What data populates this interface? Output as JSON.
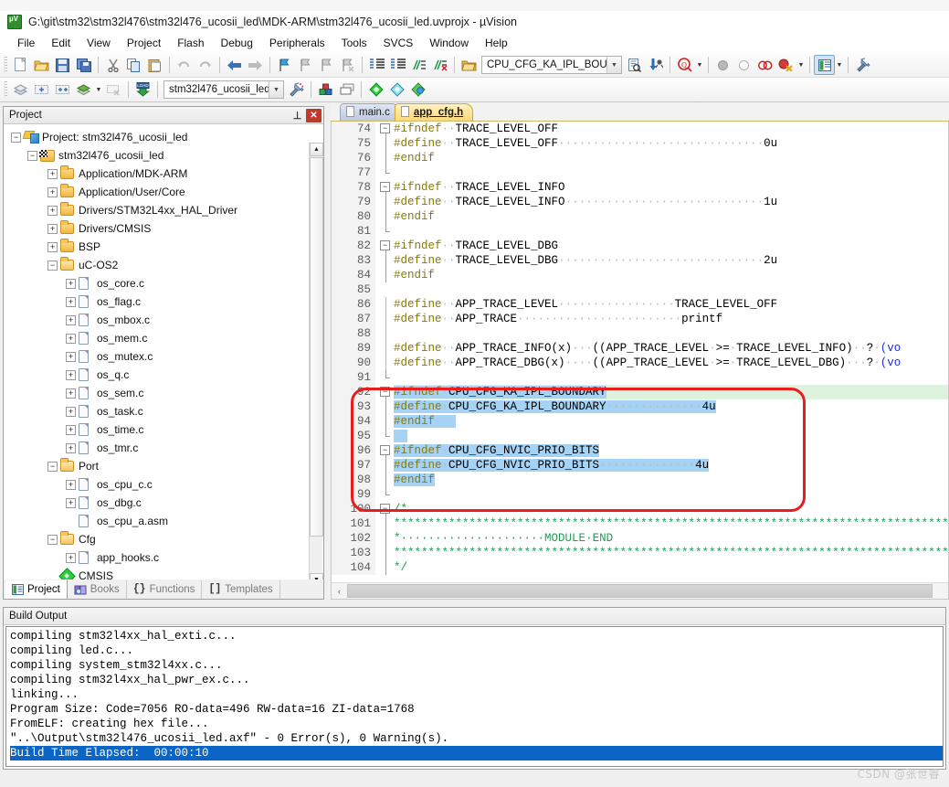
{
  "window": {
    "title": "G:\\git\\stm32\\stm32l476\\stm32l476_ucosii_led\\MDK-ARM\\stm32l476_ucosii_led.uvprojx - µVision",
    "app_icon": "uvision-icon"
  },
  "menubar": {
    "items": [
      {
        "label": "File"
      },
      {
        "label": "Edit"
      },
      {
        "label": "View"
      },
      {
        "label": "Project"
      },
      {
        "label": "Flash"
      },
      {
        "label": "Debug"
      },
      {
        "label": "Peripherals"
      },
      {
        "label": "Tools"
      },
      {
        "label": "SVCS"
      },
      {
        "label": "Window"
      },
      {
        "label": "Help"
      }
    ]
  },
  "toolbar": {
    "target_combo_value": "stm32l476_ucosii_led",
    "search_combo_value": "CPU_CFG_KA_IPL_BOUND",
    "row1_icons": [
      "new-file-icon",
      "open-file-icon",
      "save-icon",
      "save-all-icon",
      "cut-icon",
      "copy-icon",
      "paste-icon",
      "undo-icon",
      "redo-icon",
      "navigate-back-icon",
      "navigate-forward-icon",
      "bookmark-toggle-icon",
      "bookmark-prev-icon",
      "bookmark-next-icon",
      "bookmark-clear-icon",
      "indent-icon",
      "outdent-icon",
      "comment-icon",
      "uncomment-icon"
    ],
    "row2_icons": [
      "build-icon",
      "rebuild-icon",
      "batch-build-icon",
      "translate-icon",
      "stop-build-icon",
      "download-icon"
    ],
    "row2_right_icons": [
      "target-options-icon",
      "manage-components-icon",
      "pack-installer-icon",
      "config-wizard-icon",
      "svcs-icon"
    ],
    "row1_right_icons": [
      "find-in-files-icon",
      "debug-start-icon",
      "breakpoint-icon",
      "breakpoint-disable-icon",
      "breakpoint-disable-all-icon",
      "breakpoint-kill-icon",
      "project-window-icon",
      "utilities-icon"
    ]
  },
  "project_panel": {
    "caption": "Project",
    "pin_icon": "pin-icon",
    "close_icon": "close-icon",
    "tree": [
      {
        "label": "Project: stm32l476_ucosii_led",
        "indent": 0,
        "expander": "-",
        "icon": "project-icon"
      },
      {
        "label": "stm32l476_ucosii_led",
        "indent": 1,
        "expander": "-",
        "icon": "target-icon"
      },
      {
        "label": "Application/MDK-ARM",
        "indent": 2,
        "expander": "+",
        "icon": "folder-icon"
      },
      {
        "label": "Application/User/Core",
        "indent": 2,
        "expander": "+",
        "icon": "folder-icon"
      },
      {
        "label": "Drivers/STM32L4xx_HAL_Driver",
        "indent": 2,
        "expander": "+",
        "icon": "folder-icon"
      },
      {
        "label": "Drivers/CMSIS",
        "indent": 2,
        "expander": "+",
        "icon": "folder-icon"
      },
      {
        "label": "BSP",
        "indent": 2,
        "expander": "+",
        "icon": "folder-icon"
      },
      {
        "label": "uC-OS2",
        "indent": 2,
        "expander": "-",
        "icon": "folder-open-icon"
      },
      {
        "label": "os_core.c",
        "indent": 3,
        "expander": "+",
        "icon": "source-file-icon"
      },
      {
        "label": "os_flag.c",
        "indent": 3,
        "expander": "+",
        "icon": "source-file-icon"
      },
      {
        "label": "os_mbox.c",
        "indent": 3,
        "expander": "+",
        "icon": "source-file-icon"
      },
      {
        "label": "os_mem.c",
        "indent": 3,
        "expander": "+",
        "icon": "source-file-icon"
      },
      {
        "label": "os_mutex.c",
        "indent": 3,
        "expander": "+",
        "icon": "source-file-icon"
      },
      {
        "label": "os_q.c",
        "indent": 3,
        "expander": "+",
        "icon": "source-file-icon"
      },
      {
        "label": "os_sem.c",
        "indent": 3,
        "expander": "+",
        "icon": "source-file-icon"
      },
      {
        "label": "os_task.c",
        "indent": 3,
        "expander": "+",
        "icon": "source-file-icon"
      },
      {
        "label": "os_time.c",
        "indent": 3,
        "expander": "+",
        "icon": "source-file-icon"
      },
      {
        "label": "os_tmr.c",
        "indent": 3,
        "expander": "+",
        "icon": "source-file-icon"
      },
      {
        "label": "Port",
        "indent": 2,
        "expander": "-",
        "icon": "folder-open-icon"
      },
      {
        "label": "os_cpu_c.c",
        "indent": 3,
        "expander": "+",
        "icon": "source-file-icon"
      },
      {
        "label": "os_dbg.c",
        "indent": 3,
        "expander": "+",
        "icon": "source-file-icon"
      },
      {
        "label": "os_cpu_a.asm",
        "indent": 3,
        "expander": "",
        "icon": "source-file-icon"
      },
      {
        "label": "Cfg",
        "indent": 2,
        "expander": "-",
        "icon": "folder-open-icon"
      },
      {
        "label": "app_hooks.c",
        "indent": 3,
        "expander": "+",
        "icon": "source-file-icon"
      },
      {
        "label": "CMSIS",
        "indent": 2,
        "expander": "",
        "icon": "cmsis-icon"
      }
    ],
    "bottom_tabs": [
      {
        "label": "Project",
        "selected": true,
        "icon": "project-tab-icon"
      },
      {
        "label": "Books",
        "selected": false,
        "icon": "books-tab-icon"
      },
      {
        "label": "Functions",
        "selected": false,
        "icon": "functions-tab-icon"
      },
      {
        "label": "Templates",
        "selected": false,
        "icon": "templates-tab-icon"
      }
    ]
  },
  "editor": {
    "tabs": [
      {
        "label": "main.c",
        "active": false,
        "icon": "file-tab-icon"
      },
      {
        "label": "app_cfg.h",
        "active": true,
        "icon": "file-tab-icon"
      }
    ],
    "lines": [
      {
        "n": 74,
        "fold": "box-minus",
        "segs": [
          {
            "t": "#ifndef",
            "c": "kw"
          },
          {
            "t": "··",
            "c": "dots"
          },
          {
            "t": "TRACE_LEVEL_OFF",
            "c": ""
          }
        ]
      },
      {
        "n": 75,
        "fold": "line",
        "segs": [
          {
            "t": "#define",
            "c": "kw"
          },
          {
            "t": "··",
            "c": "dots"
          },
          {
            "t": "TRACE_LEVEL_OFF",
            "c": ""
          },
          {
            "t": "······························",
            "c": "dots"
          },
          {
            "t": "0u",
            "c": ""
          }
        ]
      },
      {
        "n": 76,
        "fold": "line",
        "segs": [
          {
            "t": "#endif",
            "c": "kw"
          }
        ]
      },
      {
        "n": 77,
        "fold": "tick",
        "segs": []
      },
      {
        "n": 78,
        "fold": "box-minus",
        "segs": [
          {
            "t": "#ifndef",
            "c": "kw"
          },
          {
            "t": "··",
            "c": "dots"
          },
          {
            "t": "TRACE_LEVEL_INFO",
            "c": ""
          }
        ]
      },
      {
        "n": 79,
        "fold": "line",
        "segs": [
          {
            "t": "#define",
            "c": "kw"
          },
          {
            "t": "··",
            "c": "dots"
          },
          {
            "t": "TRACE_LEVEL_INFO",
            "c": ""
          },
          {
            "t": "·····························",
            "c": "dots"
          },
          {
            "t": "1u",
            "c": ""
          }
        ]
      },
      {
        "n": 80,
        "fold": "line",
        "segs": [
          {
            "t": "#endif",
            "c": "kw"
          }
        ]
      },
      {
        "n": 81,
        "fold": "tick",
        "segs": []
      },
      {
        "n": 82,
        "fold": "box-minus",
        "segs": [
          {
            "t": "#ifndef",
            "c": "kw"
          },
          {
            "t": "··",
            "c": "dots"
          },
          {
            "t": "TRACE_LEVEL_DBG",
            "c": ""
          }
        ]
      },
      {
        "n": 83,
        "fold": "line",
        "segs": [
          {
            "t": "#define",
            "c": "kw"
          },
          {
            "t": "··",
            "c": "dots"
          },
          {
            "t": "TRACE_LEVEL_DBG",
            "c": ""
          },
          {
            "t": "······························",
            "c": "dots"
          },
          {
            "t": "2u",
            "c": ""
          }
        ]
      },
      {
        "n": 84,
        "fold": "line",
        "segs": [
          {
            "t": "#endif",
            "c": "kw"
          }
        ]
      },
      {
        "n": 85,
        "fold": "none",
        "segs": []
      },
      {
        "n": 86,
        "fold": "line2",
        "segs": [
          {
            "t": "#define",
            "c": "kw"
          },
          {
            "t": "··",
            "c": "dots"
          },
          {
            "t": "APP_TRACE_LEVEL",
            "c": ""
          },
          {
            "t": "·················",
            "c": "dots"
          },
          {
            "t": "TRACE_LEVEL_OFF",
            "c": ""
          }
        ]
      },
      {
        "n": 87,
        "fold": "line2",
        "segs": [
          {
            "t": "#define",
            "c": "kw"
          },
          {
            "t": "··",
            "c": "dots"
          },
          {
            "t": "APP_TRACE",
            "c": ""
          },
          {
            "t": "························",
            "c": "dots"
          },
          {
            "t": "printf",
            "c": ""
          }
        ]
      },
      {
        "n": 88,
        "fold": "line2",
        "segs": []
      },
      {
        "n": 89,
        "fold": "line2",
        "segs": [
          {
            "t": "#define",
            "c": "kw"
          },
          {
            "t": "··",
            "c": "dots"
          },
          {
            "t": "APP_TRACE_INFO(x)",
            "c": ""
          },
          {
            "t": "···",
            "c": "dots"
          },
          {
            "t": "((APP_TRACE_LEVEL",
            "c": ""
          },
          {
            "t": "·",
            "c": "dots"
          },
          {
            "t": ">=",
            "c": ""
          },
          {
            "t": "·",
            "c": "dots"
          },
          {
            "t": "TRACE_LEVEL_INFO)",
            "c": ""
          },
          {
            "t": "··",
            "c": "dots"
          },
          {
            "t": "?",
            "c": ""
          },
          {
            "t": "·",
            "c": "dots"
          },
          {
            "t": "(vo",
            "c": "blu"
          }
        ]
      },
      {
        "n": 90,
        "fold": "line2",
        "segs": [
          {
            "t": "#define",
            "c": "kw"
          },
          {
            "t": "··",
            "c": "dots"
          },
          {
            "t": "APP_TRACE_DBG(x)",
            "c": ""
          },
          {
            "t": "····",
            "c": "dots"
          },
          {
            "t": "((APP_TRACE_LEVEL",
            "c": ""
          },
          {
            "t": "·",
            "c": "dots"
          },
          {
            "t": ">=",
            "c": ""
          },
          {
            "t": "·",
            "c": "dots"
          },
          {
            "t": "TRACE_LEVEL_DBG)",
            "c": ""
          },
          {
            "t": "···",
            "c": "dots"
          },
          {
            "t": "?",
            "c": ""
          },
          {
            "t": "·",
            "c": "dots"
          },
          {
            "t": "(vo",
            "c": "blu"
          }
        ]
      },
      {
        "n": 91,
        "fold": "tick",
        "segs": []
      },
      {
        "n": 92,
        "fold": "box-minus",
        "current": true,
        "segs": [
          {
            "t": "#ifndef",
            "c": "kw sel"
          },
          {
            "t": "·",
            "c": "dots sel"
          },
          {
            "t": "CPU_CFG_KA_IPL_BOUNDARY",
            "c": "sel"
          }
        ]
      },
      {
        "n": 93,
        "fold": "line",
        "segs": [
          {
            "t": "#define",
            "c": "kw sel"
          },
          {
            "t": "·",
            "c": "dots sel"
          },
          {
            "t": "CPU_CFG_KA_IPL_BOUNDARY",
            "c": "sel"
          },
          {
            "t": "··············",
            "c": "dots sel"
          },
          {
            "t": "4u",
            "c": "sel"
          }
        ]
      },
      {
        "n": 94,
        "fold": "line",
        "segs": [
          {
            "t": "#endif",
            "c": "kw sel"
          },
          {
            "t": "   ",
            "c": "sel"
          }
        ]
      },
      {
        "n": 95,
        "fold": "tick",
        "segs": [
          {
            "t": "  ",
            "c": "sel"
          }
        ]
      },
      {
        "n": 96,
        "fold": "box-minus",
        "segs": [
          {
            "t": "#ifndef",
            "c": "kw sel"
          },
          {
            "t": "·",
            "c": "dots sel"
          },
          {
            "t": "CPU_CFG_NVIC_PRIO_BITS",
            "c": "sel"
          }
        ]
      },
      {
        "n": 97,
        "fold": "line",
        "segs": [
          {
            "t": "#define",
            "c": "kw sel"
          },
          {
            "t": "·",
            "c": "dots sel"
          },
          {
            "t": "CPU_CFG_NVIC_PRIO_BITS",
            "c": "sel"
          },
          {
            "t": "··············",
            "c": "dots sel"
          },
          {
            "t": "4u",
            "c": "sel"
          }
        ]
      },
      {
        "n": 98,
        "fold": "line",
        "segs": [
          {
            "t": "#endif",
            "c": "kw sel"
          }
        ]
      },
      {
        "n": 99,
        "fold": "tick",
        "segs": []
      },
      {
        "n": 100,
        "fold": "box-minus",
        "segs": [
          {
            "t": "/*",
            "c": "cmt"
          }
        ]
      },
      {
        "n": 101,
        "fold": "line",
        "segs": [
          {
            "t": "*****************************************************************************************************",
            "c": "cmt"
          }
        ]
      },
      {
        "n": 102,
        "fold": "line",
        "segs": [
          {
            "t": "*",
            "c": "cmt"
          },
          {
            "t": "·····················",
            "c": "cmt"
          },
          {
            "t": "MODULE",
            "c": "cmt"
          },
          {
            "t": "·",
            "c": "cmt"
          },
          {
            "t": "END",
            "c": "cmt"
          }
        ]
      },
      {
        "n": 103,
        "fold": "line",
        "segs": [
          {
            "t": "*****************************************************************************************************",
            "c": "cmt"
          }
        ]
      },
      {
        "n": 104,
        "fold": "line",
        "segs": [
          {
            "t": "*/",
            "c": "cmt"
          }
        ]
      }
    ],
    "annotation": {
      "shape": "red-rounded-box",
      "color": "#e81e1e"
    }
  },
  "build_output": {
    "caption": "Build Output",
    "lines": [
      {
        "text": "compiling stm32l4xx_hal_exti.c...",
        "highlight": false
      },
      {
        "text": "compiling led.c...",
        "highlight": false
      },
      {
        "text": "compiling system_stm32l4xx.c...",
        "highlight": false
      },
      {
        "text": "compiling stm32l4xx_hal_pwr_ex.c...",
        "highlight": false
      },
      {
        "text": "linking...",
        "highlight": false
      },
      {
        "text": "Program Size: Code=7056 RO-data=496 RW-data=16 ZI-data=1768",
        "highlight": false
      },
      {
        "text": "FromELF: creating hex file...",
        "highlight": false
      },
      {
        "text": "\"..\\Output\\stm32l476_ucosii_led.axf\" - 0 Error(s), 0 Warning(s).",
        "highlight": false
      },
      {
        "text": "Build Time Elapsed:  00:00:10",
        "highlight": true
      }
    ]
  },
  "watermark": {
    "text": "CSDN @张世睿"
  },
  "colors": {
    "accent_blue": "#0b65c6",
    "selection": "#a6d2f4",
    "current_line": "#ddf3dd",
    "annotation_red": "#e81e1e",
    "comment_green": "#1f9d55",
    "preproc_olive": "#8a7a00"
  }
}
